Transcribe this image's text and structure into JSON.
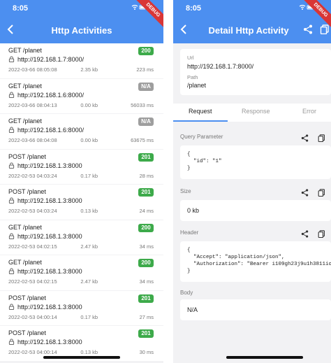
{
  "status": {
    "time": "8:05",
    "debug_ribbon": "DEBUG"
  },
  "list_screen": {
    "title": "Http Activities",
    "items": [
      {
        "method": "GET /planet",
        "url": "http://192.168.1.7:8000/",
        "date": "2022-03-66 08:05:08",
        "size": "2.35 kb",
        "duration": "223 ms",
        "status": "200"
      },
      {
        "method": "GET /planet",
        "url": "http://192.168.1.6:8000/",
        "date": "2022-03-66 08:04:13",
        "size": "0.00 kb",
        "duration": "56033 ms",
        "status": "N/A"
      },
      {
        "method": "GET /planet",
        "url": "http://192.168.1.6:8000/",
        "date": "2022-03-66 08:04:08",
        "size": "0.00 kb",
        "duration": "63675 ms",
        "status": "N/A"
      },
      {
        "method": "POST /planet",
        "url": "http://192.168.1.3:8000",
        "date": "2022-02-53 04:03:24",
        "size": "0.17 kb",
        "duration": "28 ms",
        "status": "201"
      },
      {
        "method": "POST /planet",
        "url": "http://192.168.1.3:8000",
        "date": "2022-02-53 04:03:24",
        "size": "0.13 kb",
        "duration": "24 ms",
        "status": "201"
      },
      {
        "method": "GET /planet",
        "url": "http://192.168.1.3:8000",
        "date": "2022-02-53 04:02:15",
        "size": "2.47 kb",
        "duration": "34 ms",
        "status": "200"
      },
      {
        "method": "GET /planet",
        "url": "http://192.168.1.3:8000",
        "date": "2022-02-53 04:02:15",
        "size": "2.47 kb",
        "duration": "34 ms",
        "status": "200"
      },
      {
        "method": "POST /planet",
        "url": "http://192.168.1.3:8000",
        "date": "2022-02-53 04:00:14",
        "size": "0.17 kb",
        "duration": "27 ms",
        "status": "201"
      },
      {
        "method": "POST /planet",
        "url": "http://192.168.1.3:8000",
        "date": "2022-02-53 04:00:14",
        "size": "0.13 kb",
        "duration": "30 ms",
        "status": "201"
      }
    ]
  },
  "detail_screen": {
    "title": "Detail Http Activity",
    "url_label": "Url",
    "url_value": "http://192.168.1.7:8000/",
    "path_label": "Path",
    "path_value": "/planet",
    "tabs": [
      "Request",
      "Response",
      "Error"
    ],
    "query_label": "Query Parameter",
    "query_value": "{\n  \"id\": \"1\"\n}",
    "size_label": "Size",
    "size_value": "0 kb",
    "header_label": "Header",
    "header_value": "{\n  \"Accept\": \"application/json\",\n  \"Authorization\": \"Bearer i109gh23j9u1h3811io2r\n}",
    "body_label": "Body",
    "body_value": "N/A"
  },
  "colors": {
    "primary": "#4c8ff0",
    "ok": "#3daa4a",
    "na": "#9e9e9e",
    "ribbon": "#d93636"
  }
}
